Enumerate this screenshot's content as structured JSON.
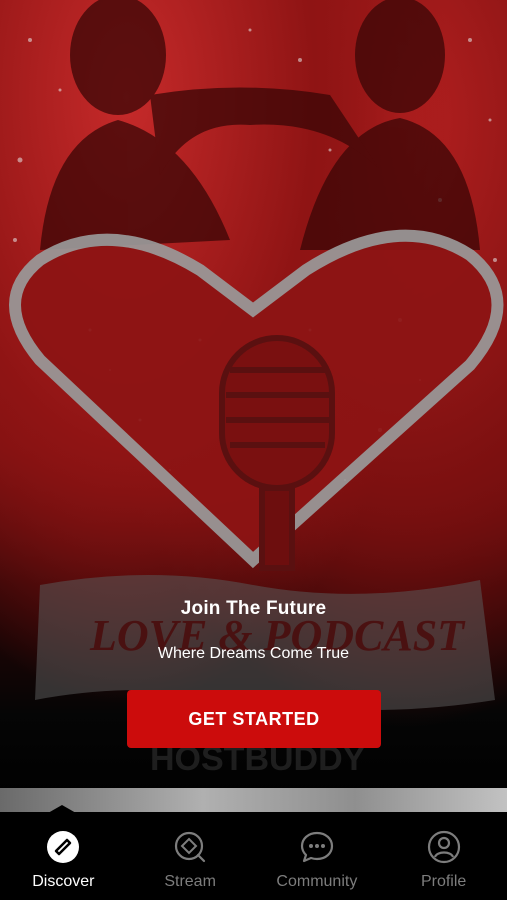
{
  "hero": {
    "artwork_banner_text": "LOVE & PODCAST",
    "artwork_lower_text": "HOSTBUDDY"
  },
  "onboarding": {
    "headline": "Join The Future",
    "subheadline": "Where Dreams Come True",
    "cta_label": "GET STARTED"
  },
  "tabbar": {
    "tabs": [
      {
        "label": "Discover",
        "icon": "compass-icon",
        "active": true
      },
      {
        "label": "Stream",
        "icon": "stream-search-icon",
        "active": false
      },
      {
        "label": "Community",
        "icon": "chat-bubble-icon",
        "active": false
      },
      {
        "label": "Profile",
        "icon": "user-icon",
        "active": false
      }
    ]
  },
  "colors": {
    "accent": "#cc0c0c",
    "tab_active": "#ffffff",
    "tab_inactive": "#7d7d7d",
    "background": "#000000"
  }
}
